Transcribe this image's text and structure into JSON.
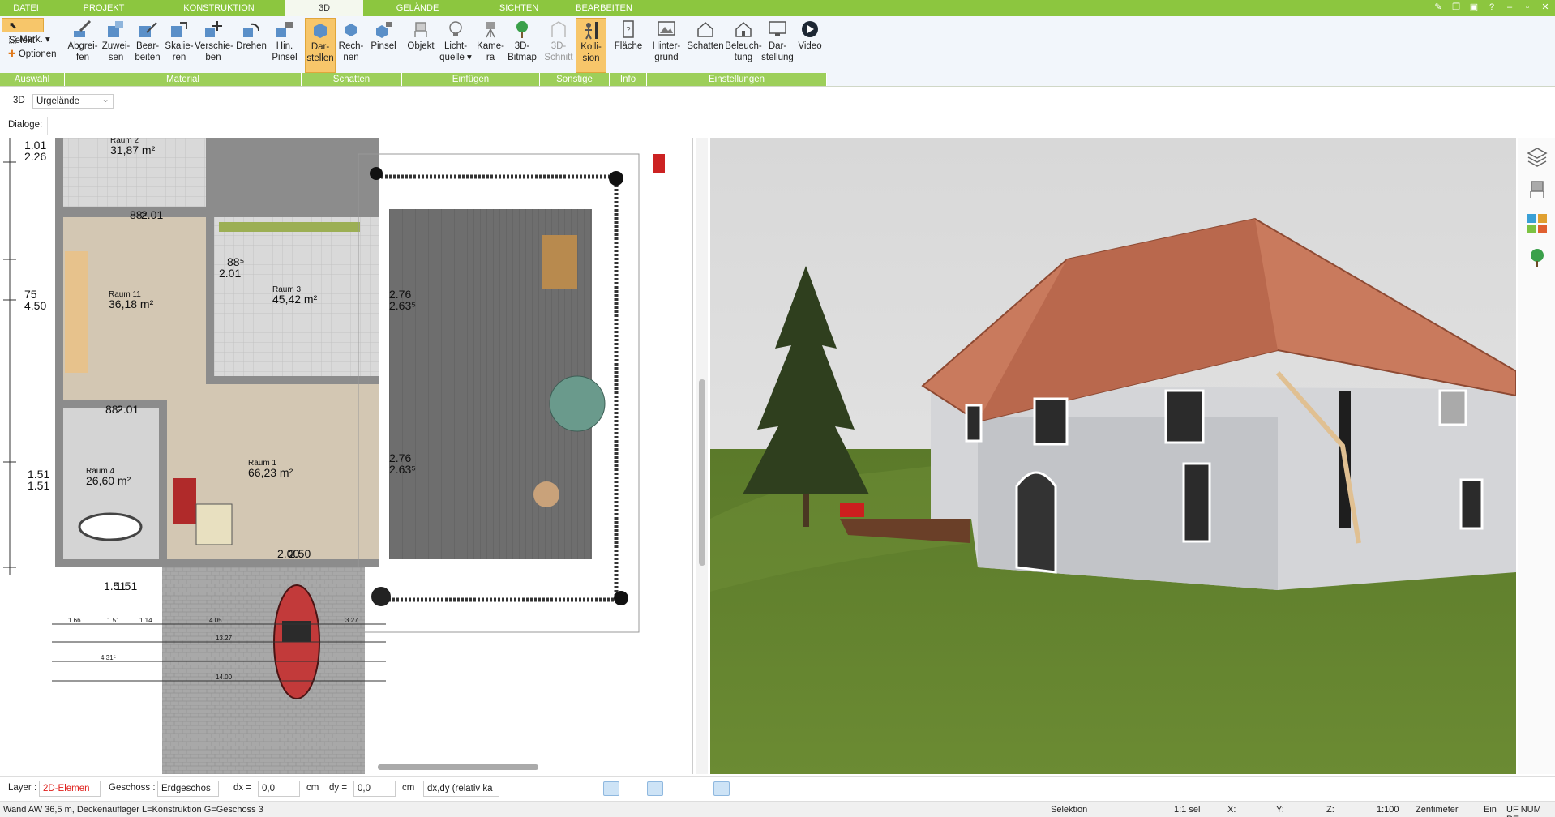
{
  "tabs": [
    {
      "label": "DATEI",
      "active": false
    },
    {
      "label": "PROJEKT",
      "active": false
    },
    {
      "label": "KONSTRUKTION",
      "active": false
    },
    {
      "label": "3D",
      "active": true
    },
    {
      "label": "GELÄNDE",
      "active": false
    },
    {
      "label": "SICHTEN",
      "active": false
    },
    {
      "label": "BEARBEITEN",
      "active": false
    }
  ],
  "window_controls": [
    "—",
    "❐",
    "?",
    "–",
    "▫",
    "✕"
  ],
  "ribbon": {
    "auswahl": {
      "selekt": "Selekt",
      "mark": "Mark.",
      "optionen": "Optionen"
    },
    "buttons": [
      {
        "l1": "Abgrei-",
        "l2": "fen",
        "icon": "eyedropper-icon"
      },
      {
        "l1": "Zuwei-",
        "l2": "sen",
        "icon": "assign-icon"
      },
      {
        "l1": "Bear-",
        "l2": "beiten",
        "icon": "edit-material-icon"
      },
      {
        "l1": "Skalie-",
        "l2": "ren",
        "icon": "scale-icon"
      },
      {
        "l1": "Verschie-",
        "l2": "ben",
        "icon": "move-icon"
      },
      {
        "l1": "Drehen",
        "l2": "",
        "icon": "rotate-icon"
      },
      {
        "l1": "Hin.",
        "l2": "Pinsel",
        "icon": "brush-icon"
      },
      {
        "l1": "Dar-",
        "l2": "stellen",
        "icon": "shadow-display-icon",
        "active": true
      },
      {
        "l1": "Rech-",
        "l2": "nen",
        "icon": "shadow-calc-icon"
      },
      {
        "l1": "Pinsel",
        "l2": "",
        "icon": "shadow-brush-icon"
      },
      {
        "l1": "Objekt",
        "l2": "",
        "icon": "chair-icon"
      },
      {
        "l1": "Licht-",
        "l2": "quelle ▾",
        "icon": "bulb-icon"
      },
      {
        "l1": "Kame-",
        "l2": "ra",
        "icon": "camera-icon"
      },
      {
        "l1": "3D-",
        "l2": "Bitmap",
        "icon": "tree-icon"
      },
      {
        "l1": "3D-",
        "l2": "Schnitt",
        "icon": "cut-icon",
        "disabled": true
      },
      {
        "l1": "Kolli-",
        "l2": "sion",
        "icon": "collision-icon",
        "active": true
      },
      {
        "l1": "Fläche",
        "l2": "",
        "icon": "area-icon"
      },
      {
        "l1": "Hinter-",
        "l2": "grund",
        "icon": "background-icon"
      },
      {
        "l1": "Schatten",
        "l2": "",
        "icon": "house-shadow-icon"
      },
      {
        "l1": "Beleuch-",
        "l2": "tung",
        "icon": "lighting-icon"
      },
      {
        "l1": "Dar-",
        "l2": "stellung",
        "icon": "display-icon"
      },
      {
        "l1": "Video",
        "l2": "",
        "icon": "play-icon"
      }
    ],
    "groups": [
      "Auswahl",
      "Material",
      "Schatten",
      "Einfügen",
      "Sonstige",
      "Info",
      "Einstellungen"
    ]
  },
  "bar3d": {
    "label": "3D",
    "select": "Urgelände"
  },
  "dialoge": "Dialoge:",
  "plan": {
    "rooms": [
      {
        "name": "Raum 2",
        "area": "31,87 m²"
      },
      {
        "name": "Raum 11",
        "area": "36,18 m²"
      },
      {
        "name": "Raum 3",
        "area": "45,42 m²"
      },
      {
        "name": "Raum 4",
        "area": "26,60 m²"
      },
      {
        "name": "Raum 1",
        "area": "66,23 m²"
      }
    ],
    "dims": [
      "1.01",
      "2.26",
      "75",
      "4.50",
      "1.51",
      "1.51",
      "88⁵",
      "2.01",
      "88⁵",
      "2.01",
      "88⁵",
      "2.01",
      "2.76",
      "2.63⁵",
      "2.76",
      "2.63⁵",
      "2.00",
      "2.50",
      "1.51",
      "1.51",
      "1.66",
      "1.51",
      "1.14",
      "4.05",
      "3.27",
      "13.27",
      "4.31⁵",
      "14.00"
    ]
  },
  "bottombar": {
    "layer_label": "Layer :",
    "layer_value": "2D-Elemen",
    "layer_color": "#e0201c",
    "geschoss_label": "Geschoss :",
    "geschoss_value": "Erdgeschos",
    "dx_label": "dx =",
    "dx_value": "0,0",
    "dx_unit": "cm",
    "dy_label": "dy =",
    "dy_value": "0,0",
    "dy_unit": "cm",
    "mode_value": "dx,dy (relativ ka"
  },
  "status": {
    "left": "Wand AW 36,5 m, Deckenauflager L=Konstruktion G=Geschoss 3",
    "selektion": "Selektion",
    "sel_count": "1:1 sel",
    "x": "X:",
    "y": "Y:",
    "z": "Z:",
    "scale": "1:100",
    "unit": "Zentimeter",
    "ein": "Ein",
    "flags": "UF NUM RF"
  }
}
